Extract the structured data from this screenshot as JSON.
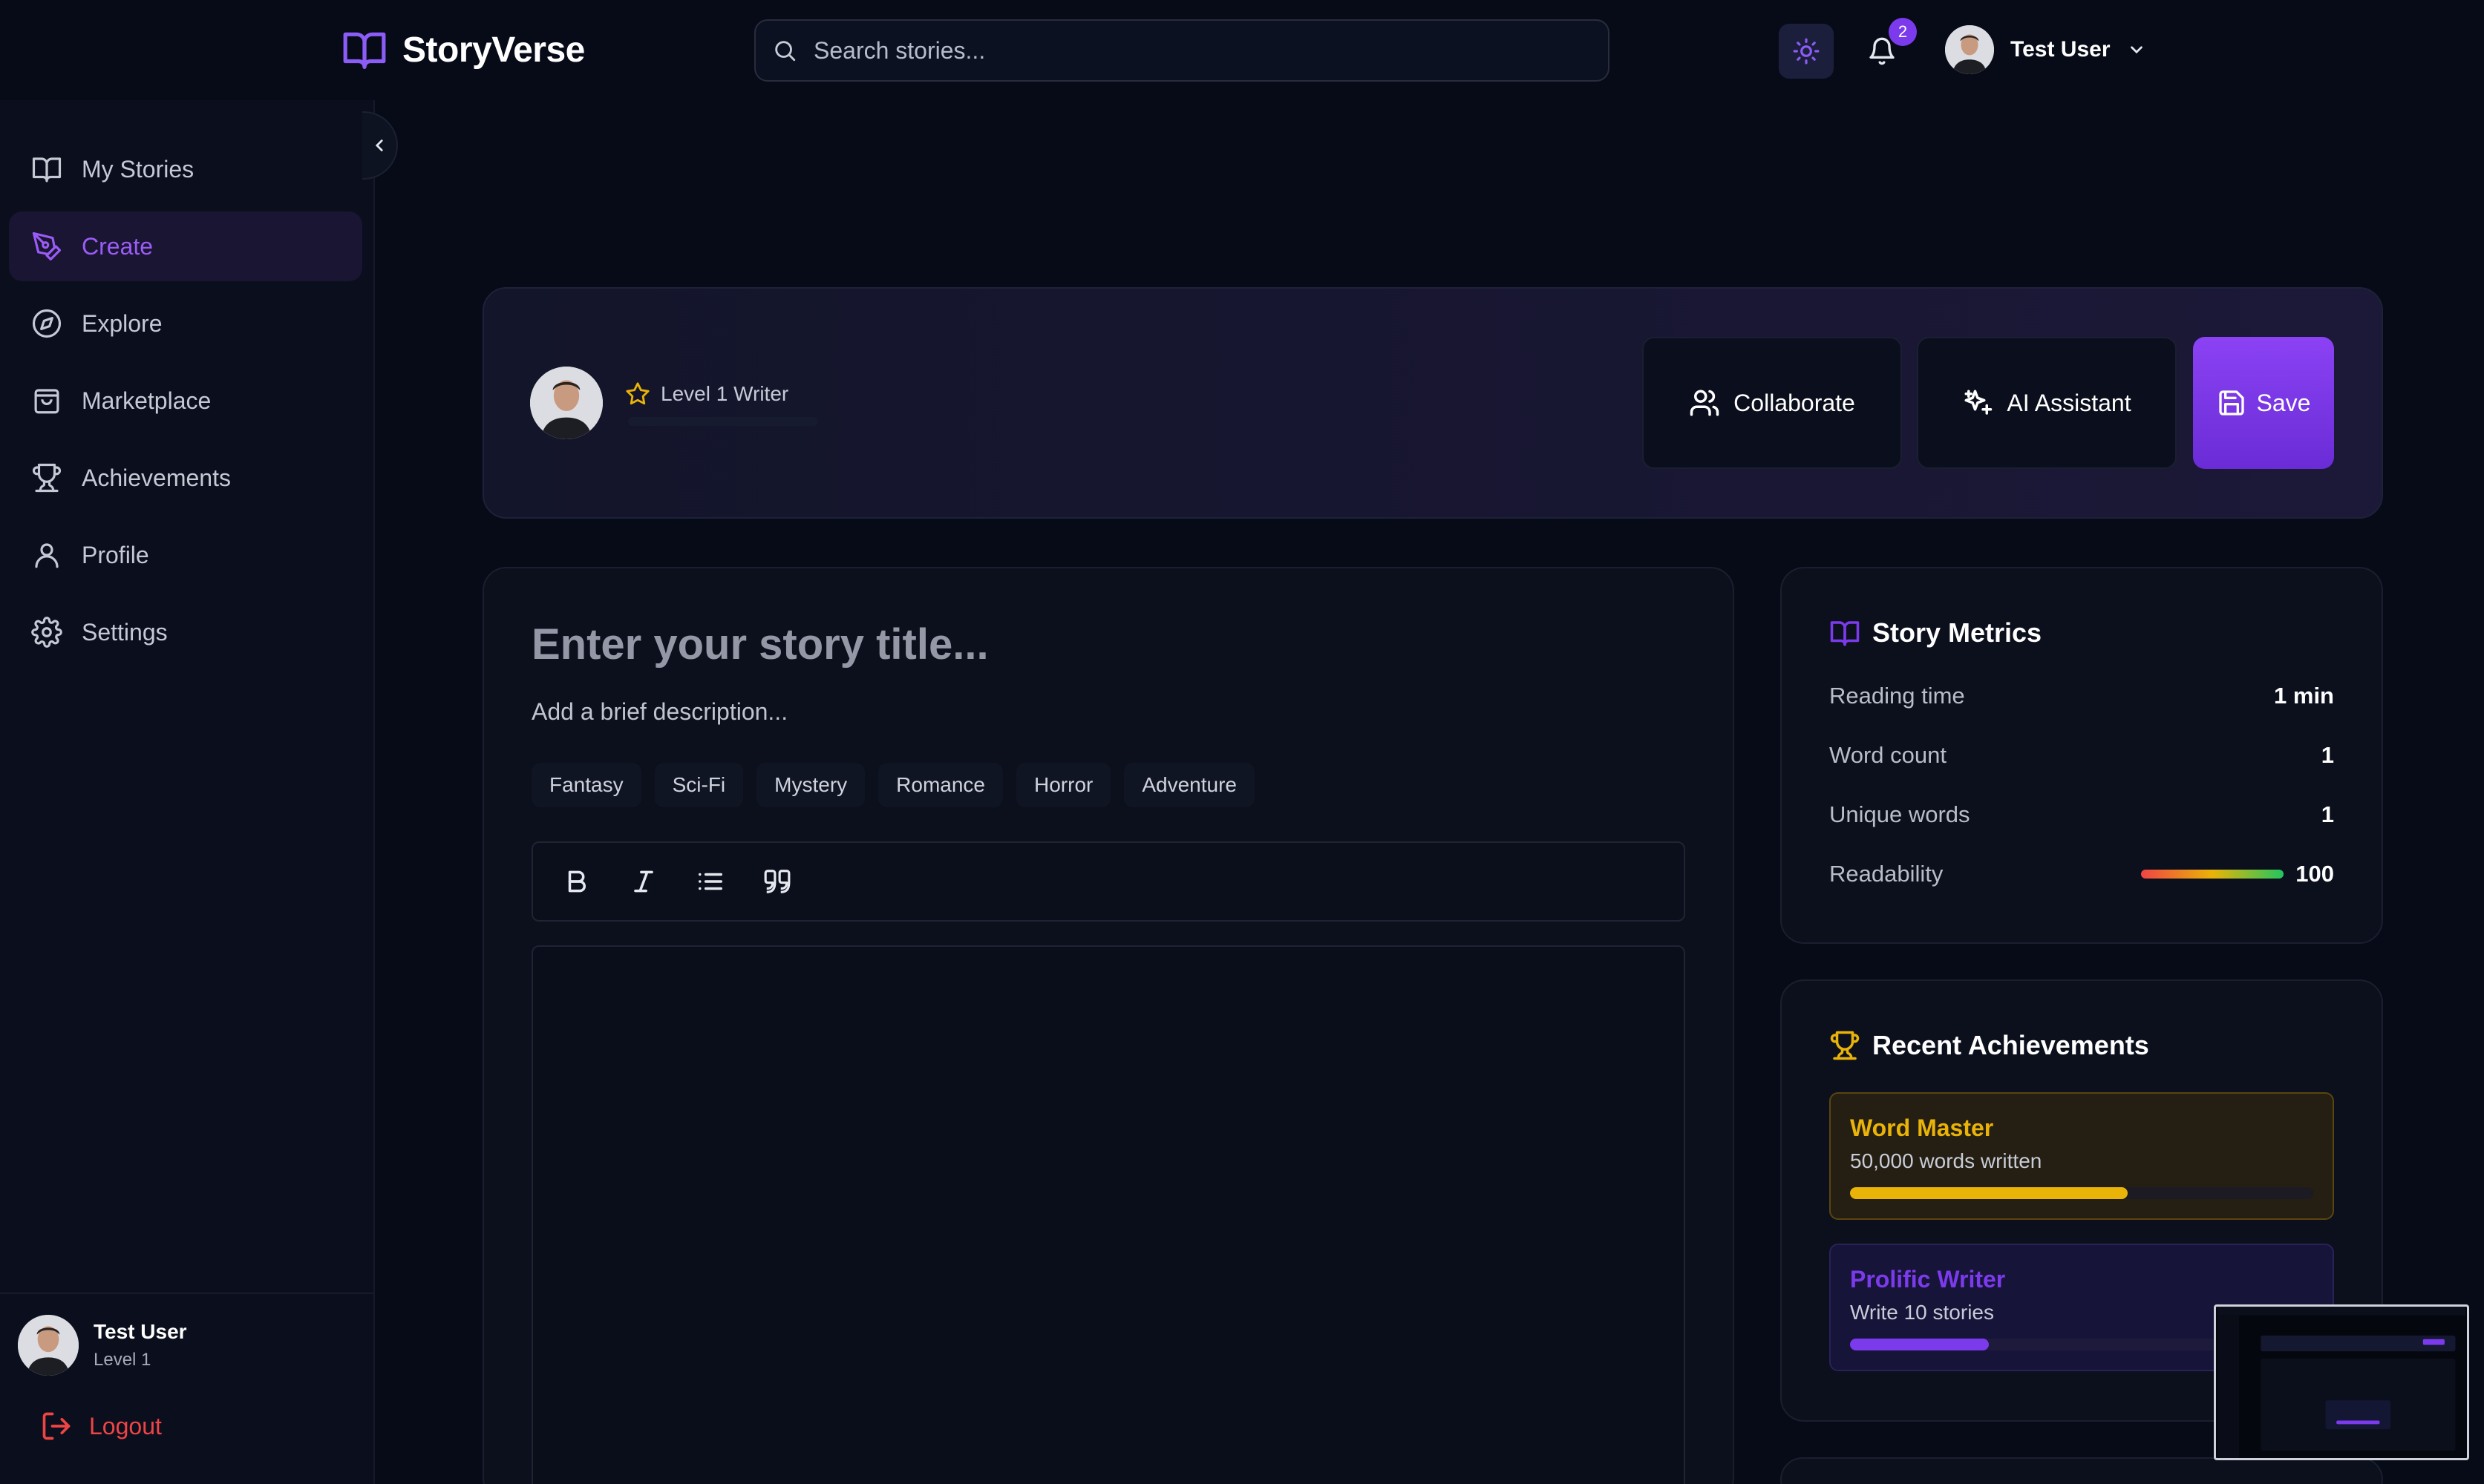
{
  "app": {
    "name": "StoryVerse"
  },
  "search": {
    "placeholder": "Search stories..."
  },
  "header": {
    "notifications_count": "2",
    "user_name": "Test User"
  },
  "sidebar": {
    "items": [
      {
        "label": "My Stories",
        "icon": "book-open-icon"
      },
      {
        "label": "Create",
        "icon": "pen-tool-icon",
        "active": true
      },
      {
        "label": "Explore",
        "icon": "compass-icon"
      },
      {
        "label": "Marketplace",
        "icon": "shopping-bag-icon"
      },
      {
        "label": "Achievements",
        "icon": "trophy-icon"
      },
      {
        "label": "Profile",
        "icon": "user-icon"
      },
      {
        "label": "Settings",
        "icon": "gear-icon"
      }
    ],
    "user": {
      "name": "Test User",
      "level": "Level 1"
    },
    "logout_label": "Logout"
  },
  "writer": {
    "level_label": "Level 1 Writer",
    "level_progress": 0
  },
  "actions": {
    "collaborate_label": "Collaborate",
    "ai_assistant_label": "AI Assistant",
    "save_label": "Save"
  },
  "editor": {
    "title_placeholder": "Enter your story title...",
    "description_placeholder": "Add a brief description...",
    "genres": [
      "Fantasy",
      "Sci-Fi",
      "Mystery",
      "Romance",
      "Horror",
      "Adventure"
    ]
  },
  "metrics": {
    "title": "Story Metrics",
    "rows": [
      {
        "label": "Reading time",
        "value": "1 min"
      },
      {
        "label": "Word count",
        "value": "1"
      },
      {
        "label": "Unique words",
        "value": "1"
      },
      {
        "label": "Readability",
        "value": "100"
      }
    ]
  },
  "achievements": {
    "title": "Recent Achievements",
    "items": [
      {
        "title": "Word Master",
        "description": "50,000 words written",
        "progress": 0.6
      },
      {
        "title": "Prolific Writer",
        "description": "Write 10 stories",
        "progress": 0.3
      }
    ]
  },
  "colors": {
    "accent": "#7c3aed",
    "gold": "#eab308",
    "danger": "#ef4444",
    "background": "#070b18"
  }
}
